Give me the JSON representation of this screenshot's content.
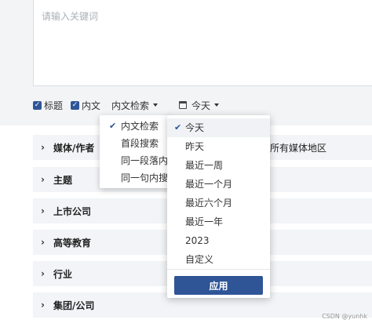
{
  "search": {
    "placeholder": "请输入关键词",
    "value": ""
  },
  "options": {
    "checkbox_title": "标题",
    "checkbox_body": "内文",
    "mode_dropdown": "内文检索",
    "time_dropdown": "今天"
  },
  "mode_menu": {
    "items": [
      {
        "label": "内文检索",
        "checked": true
      },
      {
        "label": "首段搜索"
      },
      {
        "label": "同一段落内搜"
      },
      {
        "label": "同一句内搜索"
      }
    ]
  },
  "time_menu": {
    "items": [
      {
        "label": "今天",
        "checked": true
      },
      {
        "label": "昨天"
      },
      {
        "label": "最近一周"
      },
      {
        "label": "最近一个月"
      },
      {
        "label": "最近六个月"
      },
      {
        "label": "最近一年"
      },
      {
        "label": "2023"
      },
      {
        "label": "自定义"
      }
    ],
    "apply_label": "应用"
  },
  "filters": [
    {
      "label": "媒体/作者",
      "extra": "所有媒体地区"
    },
    {
      "label": "主题"
    },
    {
      "label": "上市公司"
    },
    {
      "label": "高等教育"
    },
    {
      "label": "行业"
    },
    {
      "label": "集团/公司"
    }
  ],
  "watermark": "CSDN @yunhk",
  "icons": {
    "check": "check-icon",
    "chevron": "chevron-right-icon",
    "calendar": "calendar-icon",
    "caret": "caret-down-icon"
  },
  "colors": {
    "accent": "#2f5597",
    "panel_bg": "#f3f4f6",
    "row_bg": "#f2f4f7"
  }
}
